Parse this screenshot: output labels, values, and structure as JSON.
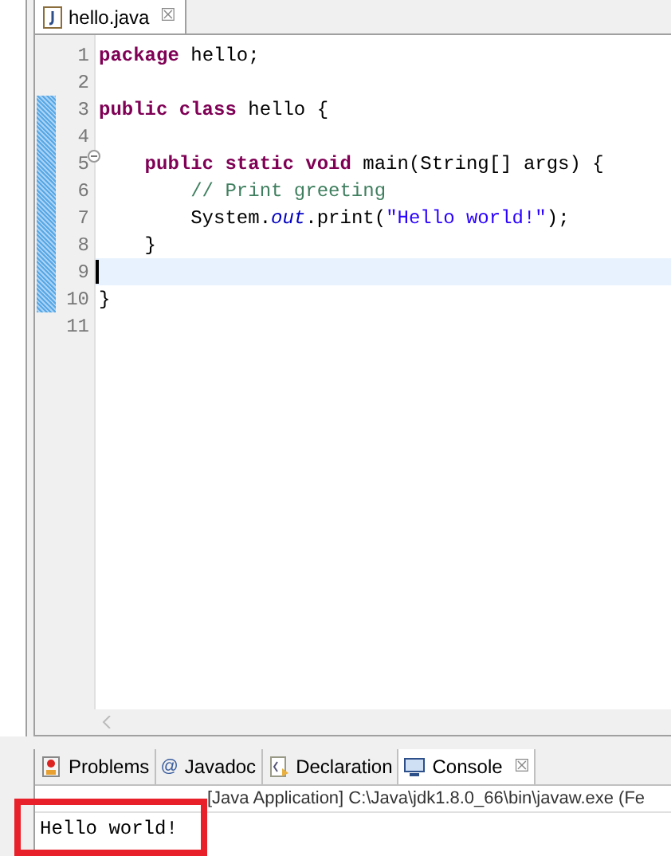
{
  "editor": {
    "tabs": [
      {
        "label": "hello.java",
        "close": "☒",
        "selected": true
      }
    ],
    "lines": [
      {
        "number": "1",
        "changed": false,
        "current": false,
        "foldable": false,
        "tokens": [
          {
            "text": "package",
            "kind": "keyword"
          },
          {
            "text": " hello;",
            "kind": "plain"
          }
        ]
      },
      {
        "number": "2",
        "changed": false,
        "current": false,
        "foldable": false
      },
      {
        "number": "3",
        "changed": true,
        "current": false,
        "foldable": false,
        "tokens": [
          {
            "text": "public class",
            "kind": "keyword"
          },
          {
            "text": " hello {",
            "kind": "plain"
          }
        ]
      },
      {
        "number": "4",
        "changed": true,
        "current": false,
        "foldable": false
      },
      {
        "number": "5",
        "changed": true,
        "current": false,
        "foldable": true,
        "tokens": [
          {
            "text": "    public static void",
            "kind": "keyword"
          },
          {
            "text": " main(String[] args) {",
            "kind": "plain"
          }
        ]
      },
      {
        "number": "6",
        "changed": true,
        "current": false,
        "foldable": false,
        "tokens": [
          {
            "text": "        // Print greeting",
            "kind": "comment"
          }
        ]
      },
      {
        "number": "7",
        "changed": true,
        "current": false,
        "foldable": false,
        "tokens": [
          {
            "text": "        System.",
            "kind": "plain"
          },
          {
            "text": "out",
            "kind": "field"
          },
          {
            "text": ".print(",
            "kind": "plain"
          },
          {
            "text": "\"Hello world!\"",
            "kind": "string"
          },
          {
            "text": ");",
            "kind": "plain"
          }
        ]
      },
      {
        "number": "8",
        "changed": true,
        "current": false,
        "foldable": false,
        "tokens": [
          {
            "text": "    }",
            "kind": "plain"
          }
        ]
      },
      {
        "number": "9",
        "changed": true,
        "current": true,
        "foldable": false
      },
      {
        "number": "10",
        "changed": true,
        "current": false,
        "foldable": false,
        "tokens": [
          {
            "text": "}",
            "kind": "plain"
          }
        ]
      },
      {
        "number": "11",
        "changed": false,
        "current": false,
        "foldable": false
      }
    ]
  },
  "bottom_panel": {
    "tabs": [
      {
        "label": "Problems",
        "kind": "problems",
        "selected": false
      },
      {
        "label": "Javadoc",
        "kind": "javadoc",
        "glyph": "@",
        "selected": false
      },
      {
        "label": "Declaration",
        "kind": "declaration",
        "selected": false
      },
      {
        "label": "Console",
        "kind": "console",
        "selected": true,
        "close": "☒"
      }
    ],
    "status": "[Java Application] C:\\Java\\jdk1.8.0_66\\bin\\javaw.exe (Fe",
    "output": "Hello world!"
  }
}
